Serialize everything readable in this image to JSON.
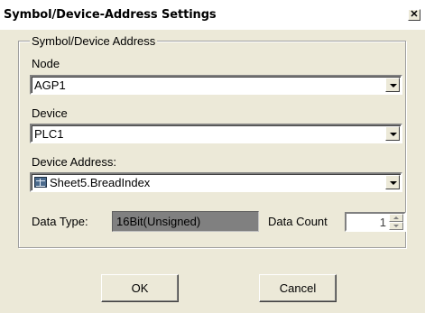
{
  "window": {
    "title": "Symbol/Device-Address Settings",
    "close_glyph": "✕"
  },
  "group": {
    "title": "Symbol/Device Address"
  },
  "node": {
    "label": "Node",
    "value": "AGP1"
  },
  "device": {
    "label": "Device",
    "value": "PLC1"
  },
  "device_address": {
    "label": "Device Address:",
    "value": "Sheet5.BreadIndex",
    "icon": "table-icon"
  },
  "data_type": {
    "label": "Data Type:",
    "value": "16Bit(Unsigned)"
  },
  "data_count": {
    "label": "Data Count",
    "value": "1"
  },
  "buttons": {
    "ok": "OK",
    "cancel": "Cancel"
  }
}
